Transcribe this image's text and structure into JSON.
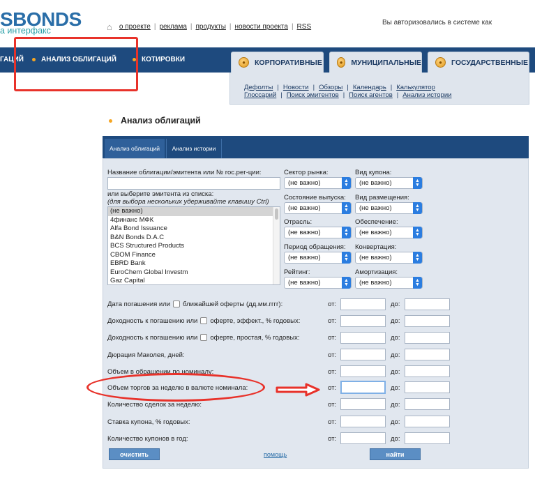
{
  "logo": {
    "main": "SBONDS",
    "sub": "а интерфакс"
  },
  "top_links": [
    "о проекте",
    "реклама",
    "продукты",
    "новости проекта",
    "RSS"
  ],
  "auth_text": "Вы авторизовались в системе как",
  "nav": {
    "item1": "ГАЦИЙ",
    "item2": "АНАЛИЗ ОБЛИГАЦИЙ",
    "item3": "КОТИРОВКИ"
  },
  "tabs": [
    "КОРПОРАТИВНЫЕ",
    "МУНИЦИПАЛЬНЫЕ",
    "ГОСУДАРСТВЕННЫЕ"
  ],
  "subnav": {
    "row1": [
      "Дефолты",
      "Новости",
      "Обзоры",
      "Календарь",
      "Калькулятор"
    ],
    "row2": [
      "Глоссарий",
      "Поиск эмитентов",
      "Поиск агентов",
      "Анализ истории"
    ]
  },
  "page_title": "Анализ облигаций",
  "form_tabs": [
    "Анализ облигаций",
    "Анализ истории"
  ],
  "form": {
    "name_label": "Название облигации/эмитента или № гос.рег-ции:",
    "choose_label": "или выберите эмитента из списка:",
    "choose_hint": "(для выбора нескольких удерживайте клавишу Ctrl)",
    "issuers": [
      "(не важно)",
      "4финанс МФК",
      "Alfa Bond Issuance",
      "B&N Bonds D.A.C",
      "BCS Structured Products",
      "CBOM Finance",
      "EBRD Bank",
      "EuroChem Global Investm",
      "Gaz Capital"
    ],
    "selects": {
      "sector": {
        "label": "Сектор рынка:",
        "value": "(не важно)"
      },
      "coupon_type": {
        "label": "Вид купона:",
        "value": "(не важно)"
      },
      "issue_state": {
        "label": "Состояние выпуска:",
        "value": "(не важно)"
      },
      "placement": {
        "label": "Вид размещения:",
        "value": "(не важно)"
      },
      "industry": {
        "label": "Отрасль:",
        "value": "(не важно)"
      },
      "security": {
        "label": "Обеспечение:",
        "value": "(не важно)"
      },
      "period": {
        "label": "Период обращения:",
        "value": "(не важно)"
      },
      "conversion": {
        "label": "Конвертация:",
        "value": "(не важно)"
      },
      "rating": {
        "label": "Рейтинг:",
        "value": "(не важно)"
      },
      "amortization": {
        "label": "Амортизация:",
        "value": "(не важно)"
      }
    },
    "ranges": [
      {
        "pre": "Дата погашения или",
        "check": true,
        "post": "ближайшей оферты (дд.мм.гггг):"
      },
      {
        "pre": "Доходность к погашению или",
        "check": true,
        "post": "оферте, эффект., % годовых:"
      },
      {
        "pre": "Доходность к погашению или",
        "check": true,
        "post": "оферте, простая, % годовых:"
      },
      {
        "pre": "Дюрация Маколея, дней:",
        "check": false,
        "post": ""
      },
      {
        "pre": "Объем в обращении по номиналу:",
        "check": false,
        "post": ""
      },
      {
        "pre": "Объем торгов за неделю в валюте номинала:",
        "check": false,
        "post": ""
      },
      {
        "pre": "Количество сделок за неделю:",
        "check": false,
        "post": ""
      },
      {
        "pre": "Ставка купона, % годовых:",
        "check": false,
        "post": ""
      },
      {
        "pre": "Количество купонов в год:",
        "check": false,
        "post": ""
      }
    ],
    "from_label": "от:",
    "to_label": "до:",
    "clear_btn": "очистить",
    "help_link": "помощь",
    "find_btn": "найти"
  },
  "colors": {
    "nav": "#1e4a7e",
    "accent": "#f5a623",
    "annotation": "#e8322a",
    "button": "#5b8ec4"
  },
  "icons": [
    "home-icon",
    "coin-icon",
    "select-arrows-icon"
  ]
}
